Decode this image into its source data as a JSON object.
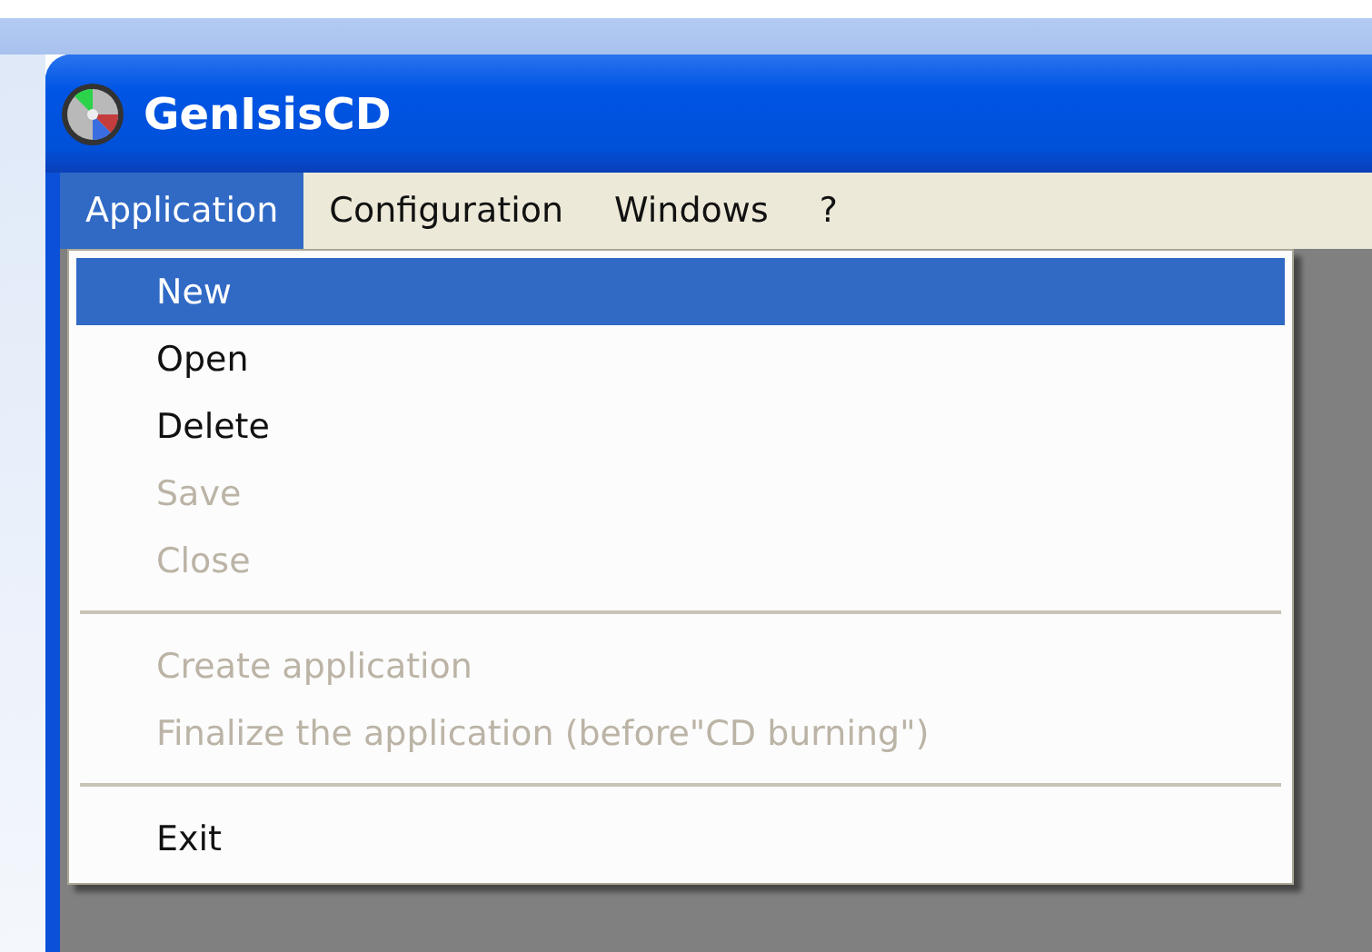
{
  "window": {
    "title": "GenIsisCD"
  },
  "menu_bar": [
    {
      "label": "Application",
      "selected": true
    },
    {
      "label": "Configuration",
      "selected": false
    },
    {
      "label": "Windows",
      "selected": false
    },
    {
      "label": "?",
      "selected": false
    }
  ],
  "dropdown": [
    {
      "kind": "item",
      "label": "New",
      "selected": true,
      "disabled": false
    },
    {
      "kind": "item",
      "label": "Open",
      "selected": false,
      "disabled": false
    },
    {
      "kind": "item",
      "label": "Delete",
      "selected": false,
      "disabled": false
    },
    {
      "kind": "item",
      "label": "Save",
      "selected": false,
      "disabled": true
    },
    {
      "kind": "item",
      "label": "Close",
      "selected": false,
      "disabled": true
    },
    {
      "kind": "separator"
    },
    {
      "kind": "item",
      "label": "Create application",
      "selected": false,
      "disabled": true
    },
    {
      "kind": "item",
      "label": "Finalize the application (before\"CD burning\")",
      "selected": false,
      "disabled": true
    },
    {
      "kind": "separator"
    },
    {
      "kind": "item",
      "label": "Exit",
      "selected": false,
      "disabled": false
    }
  ]
}
